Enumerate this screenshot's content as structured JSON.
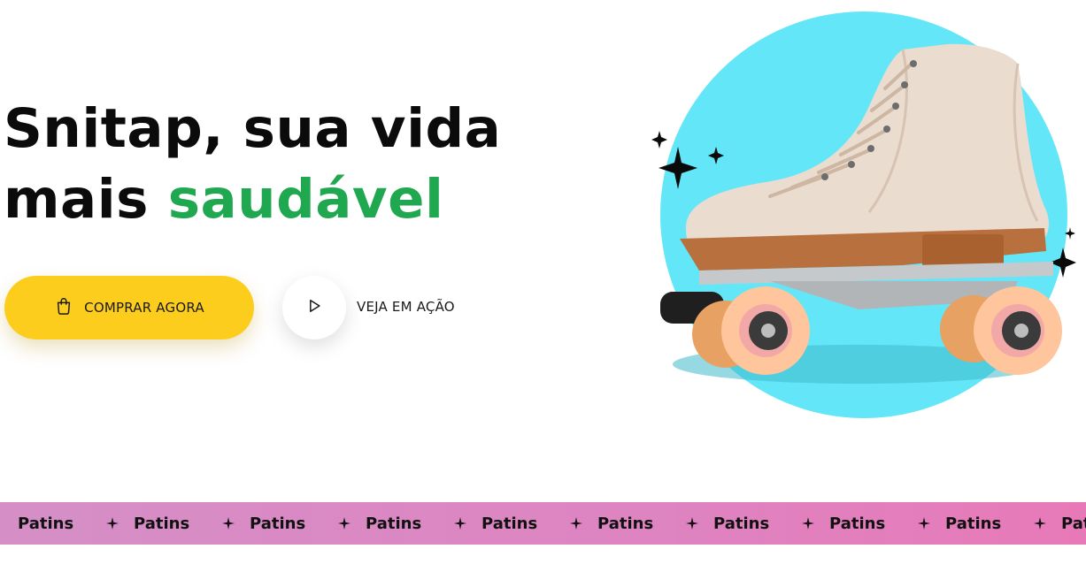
{
  "hero": {
    "title_line1": "Snitap, sua vida",
    "title_line2_plain": "mais ",
    "title_line2_accent": "saudável"
  },
  "actions": {
    "buy_label": "COMPRAR AGORA",
    "buy_icon": "shopping-bag-icon",
    "watch_label": "VEJA EM AÇÃO",
    "watch_icon": "play-icon"
  },
  "colors": {
    "accent_green": "#1fa84f",
    "button_yellow": "#fccd1d",
    "circle_cyan": "#63e6f7",
    "marquee_pink": "#de84c1"
  },
  "marquee": {
    "items": [
      "Patins",
      "Patins",
      "Patins",
      "Patins",
      "Patins",
      "Patins",
      "Patins",
      "Patins",
      "Patins",
      "Patins"
    ],
    "separator_icon": "four-point-star-icon"
  },
  "image": {
    "subject": "roller-skate-icon"
  }
}
